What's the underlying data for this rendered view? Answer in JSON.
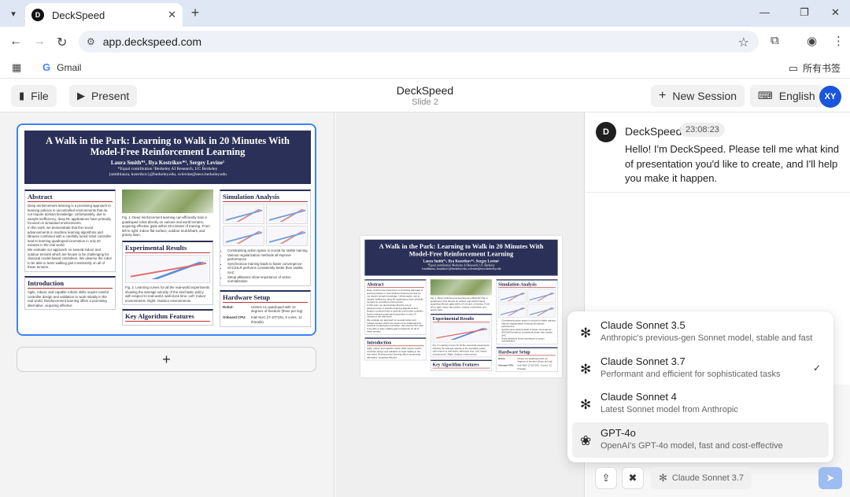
{
  "browser": {
    "tab_title": "DeckSpeed",
    "tab_favicon": "D",
    "url": "app.deckspeed.com",
    "bookmark_gmail": "Gmail",
    "bookmark_folder": "所有书签"
  },
  "header": {
    "file_label": "File",
    "present_label": "Present",
    "title": "DeckSpeed",
    "subtitle": "Slide 2",
    "new_session_label": "New Session",
    "language_label": "English",
    "avatar_initials": "XY"
  },
  "poster": {
    "title": "A Walk in the Park: Learning to Walk in 20 Minutes With Model-Free Reinforcement Learning",
    "authors": "Laura Smith*¹, Ilya Kostrikov*¹, Sergey Levine¹",
    "affiliation": "*Equal contribution ¹Berkeley AI Research, UC Berkeley",
    "emails": "{smithlaura, kostrikov}@berkeley.edu, svlevine@eecs.berkeley.edu",
    "abstract_title": "Abstract",
    "abstract_text_1": "Deep reinforcement learning is a promising approach to learning policies in uncontrolled environments that do not require domain knowledge. Unfortunately, due to sample inefficiency, deep RL applications have primarily focused on simulated environments.",
    "abstract_text_2": "In this work, we demonstrate that the recent advancements in machine learning algorithms and libraries combined with a carefully tuned robot controller lead to learning quadruped locomotion in only 20 minutes in the real world.",
    "abstract_text_3": "We evaluate our approach on several indoor and outdoor terrains which are known to be challenging for classical model-based controllers. We observe the robot to be able to learn walking gait consistently on all of these terrains.",
    "intro_title": "Introduction",
    "intro_text": "Agile, robust, and capable robotic skills require careful controller design and validation to work reliably in the real world. Reinforcement learning offers a promising alternative, acquiring effective",
    "fig1_caption": "Fig. 1: Deep reinforcement learning can efficiently train a quadruped robot directly on various real world terrains, acquiring effective gaits within 20 minutes of training. From left to right: indoor flat surface, outdoor mulch/bark, and grassy lawn.",
    "exp_title": "Experimental Results",
    "fig2_caption": "Fig. 2: Learning curves for all the real-world experiments showing the average velocity of the stochastic policy with respect to real-world, wall-clock time. Left: Indoor environments. Right: Outdoor environments.",
    "algo_title": "Key Algorithm Features",
    "sim_title": "Simulation Analysis",
    "sim_bullets": [
      "Constraining action space is crucial for stable training",
      "Various regularization methods all improve performance",
      "Synchronous training leads to faster convergence",
      "SAC/HLR performs consistently better than vanilla SAC",
      "Setup ablations show importance of action normalization"
    ],
    "hw_title": "Hardware Setup",
    "hw_robot_label": "Robot:",
    "hw_robot_value": "Unitree A1 quadruped with 12 degrees of freedom (three per leg)",
    "hw_onboard_label": "Onboard CPU:",
    "hw_onboard_value": "Intel NUC (i7-10710U, 6 cores, 12 threads)"
  },
  "chat": {
    "bot_name": "DeckSpeed",
    "bot_avatar": "D",
    "timestamp": "23:08:23",
    "message": "Hello! I'm DeckSpeed. Please tell me what kind of presentation you'd like to create, and I'll help you make it happen."
  },
  "model_menu": {
    "items": [
      {
        "name": "Claude Sonnet 3.5",
        "desc": "Anthropic's previous-gen Sonnet model, stable and fast",
        "icon": "claude-icon"
      },
      {
        "name": "Claude Sonnet 3.7",
        "desc": "Performant and efficient for sophisticated tasks",
        "icon": "claude-icon",
        "selected": true
      },
      {
        "name": "Claude Sonnet 4",
        "desc": "Latest Sonnet model from Anthropic",
        "icon": "claude-icon"
      },
      {
        "name": "GPT-4o",
        "desc": "OpenAI's GPT-4o model, fast and cost-effective",
        "icon": "openai-icon"
      }
    ]
  },
  "chat_input": {
    "selected_model": "Claude Sonnet 3.7"
  },
  "colors": {
    "accent": "#1a56db",
    "selection_border": "#3b82f6",
    "poster_header": "#2a3057",
    "send_button": "#9cbcf2"
  }
}
